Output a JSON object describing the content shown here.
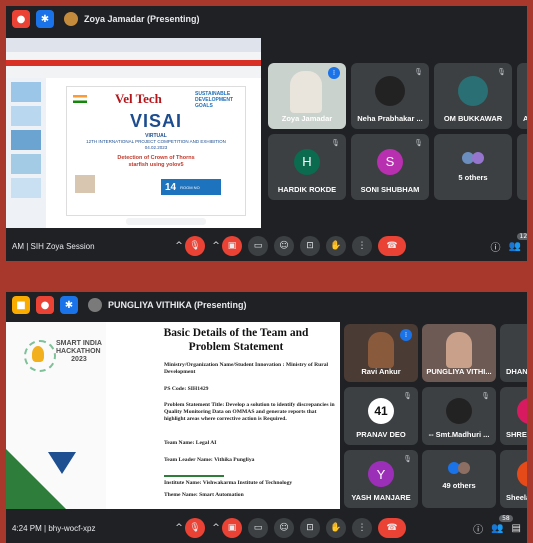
{
  "call1": {
    "presenter": "Zoya Jamadar (Presenting)",
    "meeting_info": "AM  |  SIH Zoya Session",
    "slide": {
      "org1": "Vel Tech",
      "org2": "SUSTAINABLE DEVELOPMENT GOALS",
      "title": "VISAI",
      "line1": "VIRTUAL",
      "line2": "12TH INTERNATIONAL PROJECT COMPETITION AND EXHIBITION",
      "line3": "04.02.2023",
      "topic": "Detection of Crown of Thorns starfish using yolov5",
      "room_num": "14",
      "room_label": "ROOM NO"
    },
    "tiles": [
      {
        "name": "Zoya Jamadar"
      },
      {
        "name": "Neha Prabhakar ..."
      },
      {
        "name": "OM BUKKAWAR"
      },
      {
        "name": "A"
      },
      {
        "name": "HARDIK ROKDE",
        "initial": "H",
        "color": "#0b6b4f"
      },
      {
        "name": "SONI SHUBHAM",
        "initial": "S",
        "color": "#b82fb0"
      },
      {
        "name": "5 others"
      },
      {
        "name": ""
      }
    ],
    "people_count": "12"
  },
  "call2": {
    "presenter": "PUNGLIYA VITHIKA (Presenting)",
    "meeting_info": "4:24 PM  |  bhy-wocf-xpz",
    "slide": {
      "logo_text1": "SMART INDIA",
      "logo_text2": "HACKATHON",
      "logo_text3": "2023",
      "heading1": "Basic Details of the Team and",
      "heading2": "Problem Statement",
      "ministry": "Ministry/Organization Name/Student Innovation : Ministry of Rural Development",
      "ps_code": "PS Code: SIH1429",
      "ps_title": "Problem Statement Title: Develop a solution to identify discrepancies in Quality Monitoring Data on OMMAS and generate reports that highlight areas where corrective action is Required.",
      "team": "Team Name: Legal AI",
      "leader": "Team Leader Name: Vithika Pungliya",
      "institute": "Institute Name: Vishwakarma Institute of Technology",
      "theme": "Theme Name: Smart Automation"
    },
    "tiles": [
      {
        "name": "Ravi Ankur"
      },
      {
        "name": "PUNGLIYA VITHI..."
      },
      {
        "name": "DHANA"
      },
      {
        "name": "PRANAV DEO",
        "initial": "41",
        "color": "#111111"
      },
      {
        "name": "-- Smt.Madhuri ..."
      },
      {
        "name": "SHREYA"
      },
      {
        "name": "YASH MANJARE",
        "initial": "Y",
        "color": "#9c2fb8"
      },
      {
        "name": "49 others"
      },
      {
        "name": "Sheela G"
      }
    ],
    "people_count": "58"
  }
}
